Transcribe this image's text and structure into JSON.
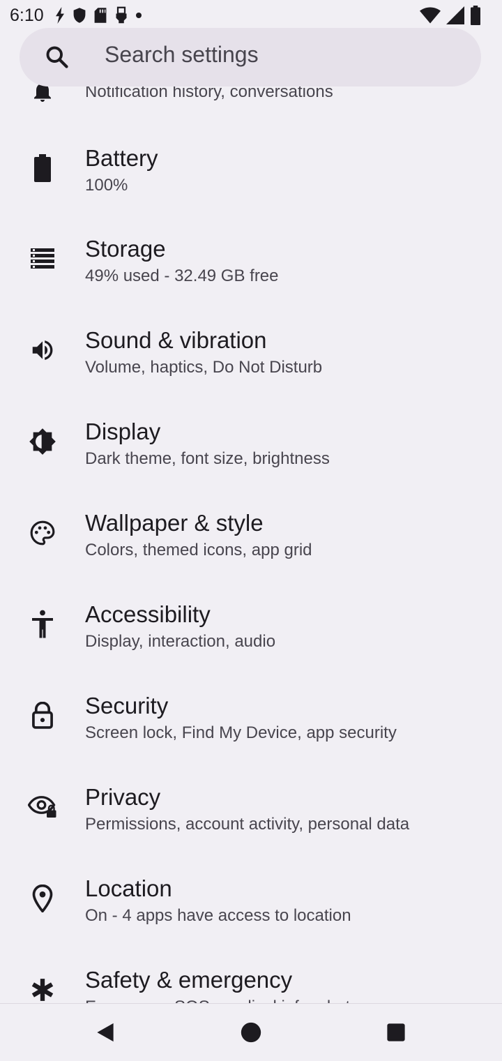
{
  "status_bar": {
    "time": "6:10",
    "left_icons": [
      "flash-icon",
      "shield-icon",
      "sd-card-icon",
      "usb-icon",
      "dot-icon"
    ],
    "right_icons": [
      "wifi-icon",
      "signal-icon",
      "battery-icon"
    ]
  },
  "search": {
    "placeholder": "Search settings"
  },
  "settings": [
    {
      "id": "notifications",
      "icon": "notifications-icon",
      "title": "",
      "summary": "Notification history, conversations"
    },
    {
      "id": "battery",
      "icon": "battery-icon",
      "title": "Battery",
      "summary": "100%"
    },
    {
      "id": "storage",
      "icon": "storage-icon",
      "title": "Storage",
      "summary": "49% used - 32.49 GB free"
    },
    {
      "id": "sound",
      "icon": "volume-icon",
      "title": "Sound & vibration",
      "summary": "Volume, haptics, Do Not Disturb"
    },
    {
      "id": "display",
      "icon": "brightness-icon",
      "title": "Display",
      "summary": "Dark theme, font size, brightness"
    },
    {
      "id": "wallpaper",
      "icon": "palette-icon",
      "title": "Wallpaper & style",
      "summary": "Colors, themed icons, app grid"
    },
    {
      "id": "accessibility",
      "icon": "accessibility-icon",
      "title": "Accessibility",
      "summary": "Display, interaction, audio"
    },
    {
      "id": "security",
      "icon": "lock-icon",
      "title": "Security",
      "summary": "Screen lock, Find My Device, app security"
    },
    {
      "id": "privacy",
      "icon": "eye-lock-icon",
      "title": "Privacy",
      "summary": "Permissions, account activity, personal data"
    },
    {
      "id": "location",
      "icon": "location-pin-icon",
      "title": "Location",
      "summary": "On - 4 apps have access to location"
    },
    {
      "id": "safety",
      "icon": "emergency-icon",
      "title": "Safety & emergency",
      "summary": "Emergency SOS, medical info, alerts"
    }
  ],
  "nav_bar": {
    "buttons": [
      "back-icon",
      "home-icon",
      "recents-icon"
    ]
  },
  "colors": {
    "background": "#f1eff4",
    "search_bg": "#e6e1ea",
    "title_text": "#1d1b20",
    "summary_text": "#48454e",
    "icon": "#1d1b20"
  }
}
